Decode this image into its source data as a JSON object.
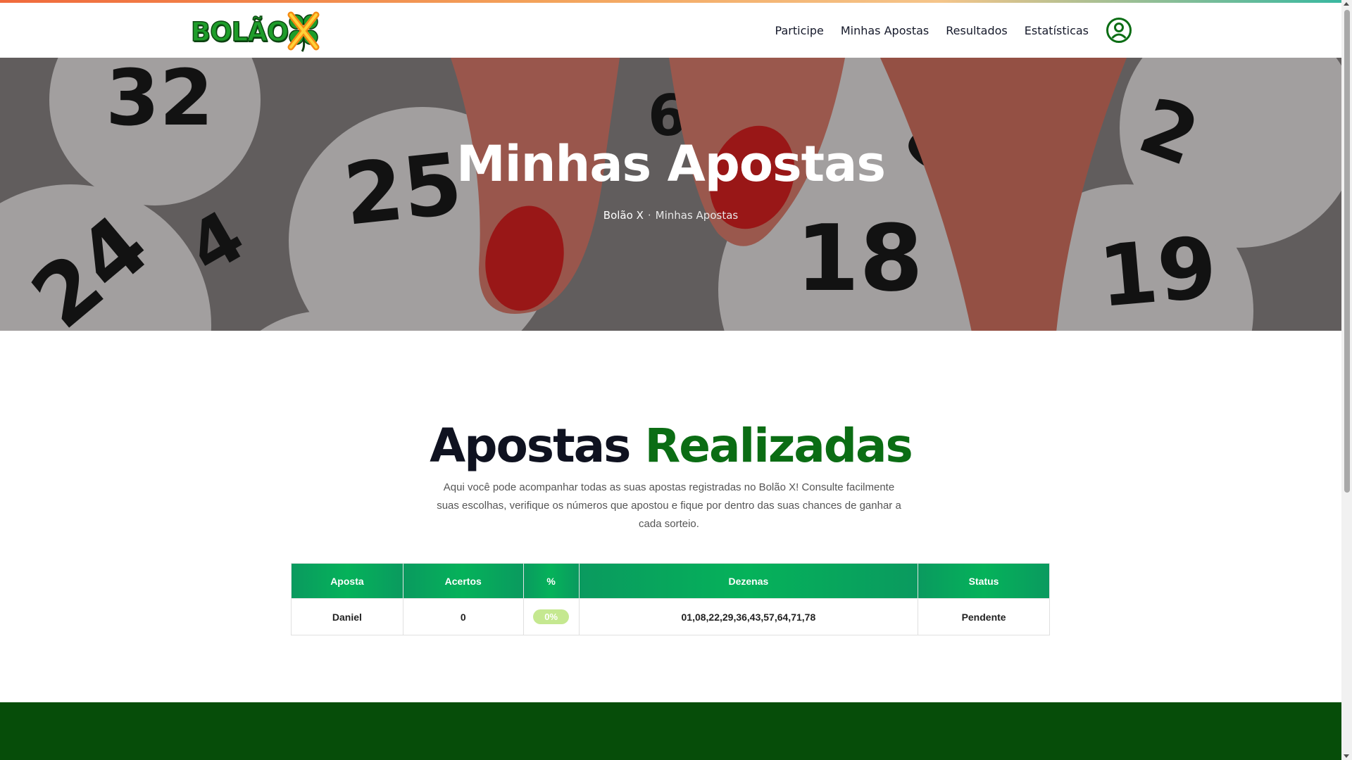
{
  "header": {
    "logo_text": "BOLÃO",
    "nav": [
      {
        "label": "Participe"
      },
      {
        "label": "Minhas Apostas"
      },
      {
        "label": "Resultados"
      },
      {
        "label": "Estatísticas"
      }
    ],
    "user_icon": "user-circle-icon"
  },
  "hero": {
    "title": "Minhas Apostas",
    "breadcrumb": {
      "home": "Bolão X",
      "separator": "·",
      "current": "Minhas Apostas"
    },
    "ball_numbers": [
      "32",
      "25",
      "24",
      "4",
      "18",
      "19",
      "2",
      "8",
      "6"
    ]
  },
  "section": {
    "title_part1": "Apostas",
    "title_part2": "Realizadas",
    "description": "Aqui você pode acompanhar todas as suas apostas registradas no Bolão X! Consulte facilmente suas escolhas, verifique os números que apostou e fique por dentro das suas chances de ganhar a cada sorteio."
  },
  "table": {
    "headers": [
      "Aposta",
      "Acertos",
      "%",
      "Dezenas",
      "Status"
    ],
    "rows": [
      {
        "aposta": "Daniel",
        "acertos": "0",
        "percent": "0%",
        "dezenas": "01,08,22,29,36,43,57,64,71,78",
        "status": "Pendente"
      }
    ]
  },
  "colors": {
    "brand_green": "#0b6d14",
    "table_header": "#05b25a",
    "footer": "#064d09",
    "badge": "#c5e890"
  }
}
